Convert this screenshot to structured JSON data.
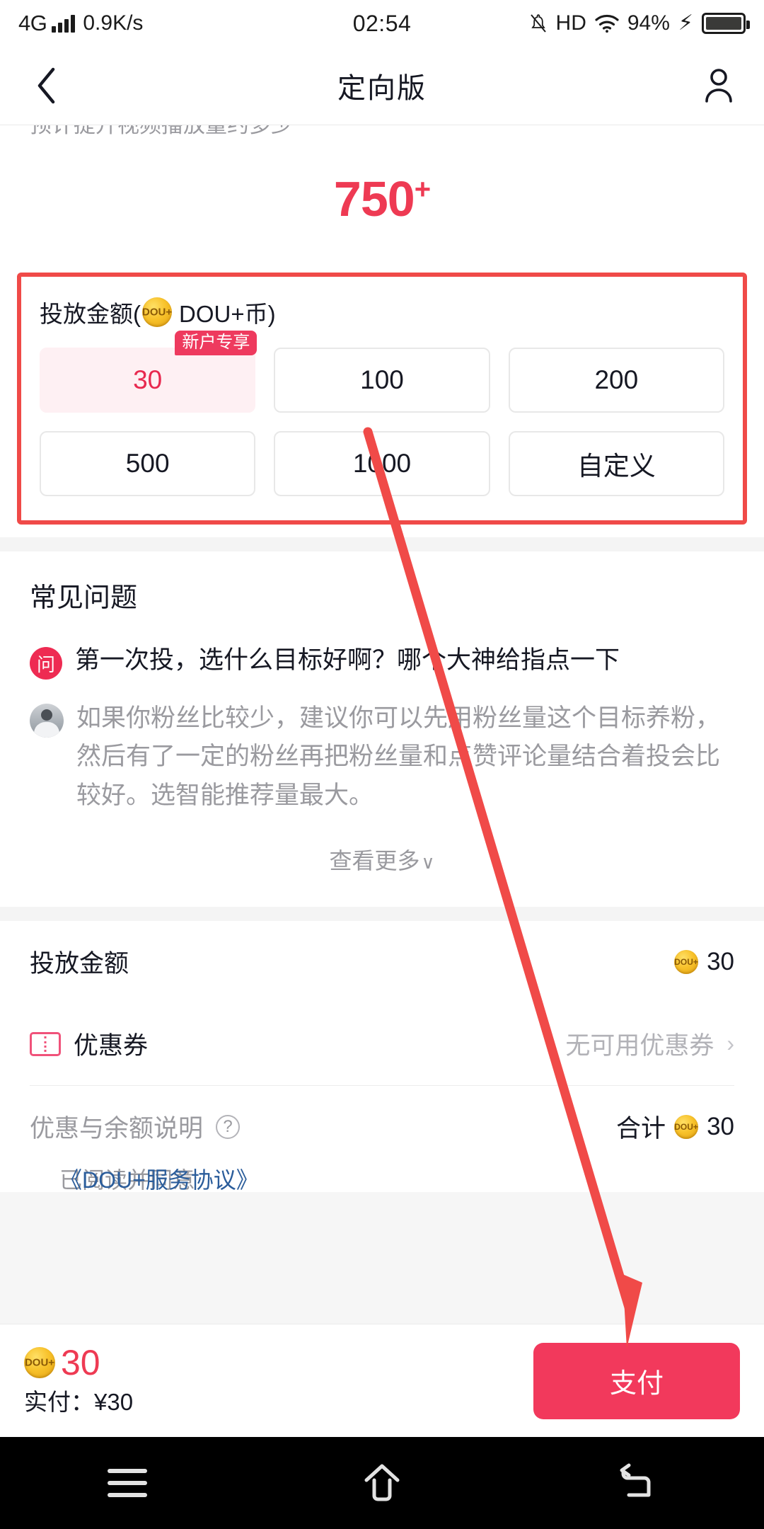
{
  "status_bar": {
    "network": "4G",
    "speed": "0.9K/s",
    "time": "02:54",
    "hd": "HD",
    "battery_percent": "94%",
    "mute_icon": "bell-muted-icon",
    "wifi_icon": "wifi-icon",
    "battery_icon": "battery-icon",
    "charging_icon": "lightning-bolt-icon"
  },
  "nav": {
    "back_icon": "chevron-left-icon",
    "title": "定向版",
    "user_icon": "person-icon"
  },
  "scroll_top_clipped": "预计提升视频播放量约多少",
  "estimate": {
    "value": "750",
    "suffix": "+"
  },
  "amount_card": {
    "title_prefix": "投放金额(",
    "coin_label": "DOU+",
    "title_suffix": "DOU+币)",
    "options": [
      {
        "label": "30",
        "badge": "新户专享",
        "selected": true
      },
      {
        "label": "100",
        "badge": "",
        "selected": false
      },
      {
        "label": "200",
        "badge": "",
        "selected": false
      },
      {
        "label": "500",
        "badge": "",
        "selected": false
      },
      {
        "label": "1000",
        "badge": "",
        "selected": false
      },
      {
        "label": "自定义",
        "badge": "",
        "selected": false
      }
    ]
  },
  "faq": {
    "heading": "常见问题",
    "question_badge": "问",
    "question": "第一次投，选什么目标好啊？哪个大神给指点一下",
    "answer": "如果你粉丝比较少，建议你可以先用粉丝量这个目标养粉，然后有了一定的粉丝再把粉丝量和点赞评论量结合着投会比较好。选智能推荐量最大。",
    "more_label": "查看更多",
    "more_chevron": "∨"
  },
  "summary": {
    "amount_row": {
      "label": "投放金额",
      "coin_label": "DOU+",
      "value": "30"
    },
    "coupon_row": {
      "icon": "ticket-icon",
      "label": "优惠券",
      "value": "无可用优惠券",
      "chevron": "›"
    },
    "total_row": {
      "note_label": "优惠与余额说明",
      "help_icon": "question-mark-icon",
      "total_label": "合计",
      "coin_label": "DOU+",
      "total_value": "30"
    }
  },
  "agreement_clipped": {
    "prefix": "已阅读并同意",
    "link": "《DOU+服务协议》"
  },
  "pay_bar": {
    "coin_label": "DOU+",
    "coin_amount": "30",
    "actual_label": "实付：¥30",
    "pay_button": "支付"
  },
  "android_nav": {
    "recents_icon": "menu-icon",
    "home_icon": "home-icon",
    "back_icon": "back-arrow-icon"
  },
  "annotation": {
    "highlight_color": "#F04A48",
    "arrow_color": "#F04A48"
  },
  "colors": {
    "brand_pink": "#EE3A53",
    "pay_button": "#F2395C",
    "selected_bg": "#FEF0F3",
    "coin_gold": "#F8C22B"
  }
}
